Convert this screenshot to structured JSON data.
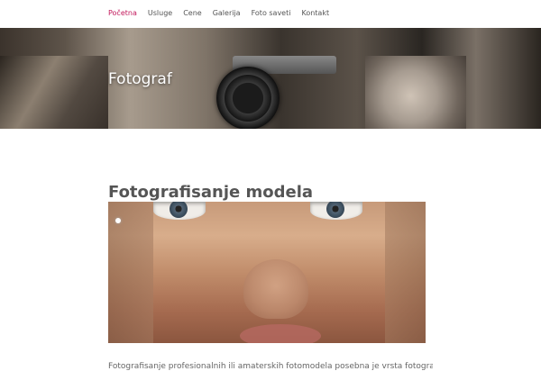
{
  "nav": {
    "items": [
      {
        "label": "Početna",
        "active": true
      },
      {
        "label": "Usluge"
      },
      {
        "label": "Cene"
      },
      {
        "label": "Galerija"
      },
      {
        "label": "Foto saveti"
      },
      {
        "label": "Kontakt"
      }
    ],
    "accent": "#c2185b"
  },
  "hero": {
    "title": "Fotograf"
  },
  "main": {
    "heading": "Fotografisanje modela",
    "intro": "Fotografisanje profesionalnih ili amaterskih fotomodela posebna je vrsta fotografske"
  },
  "icons": {
    "photo_hero": "photographer-camera-banner-image",
    "photo_portrait": "woman-face-closeup-image"
  }
}
